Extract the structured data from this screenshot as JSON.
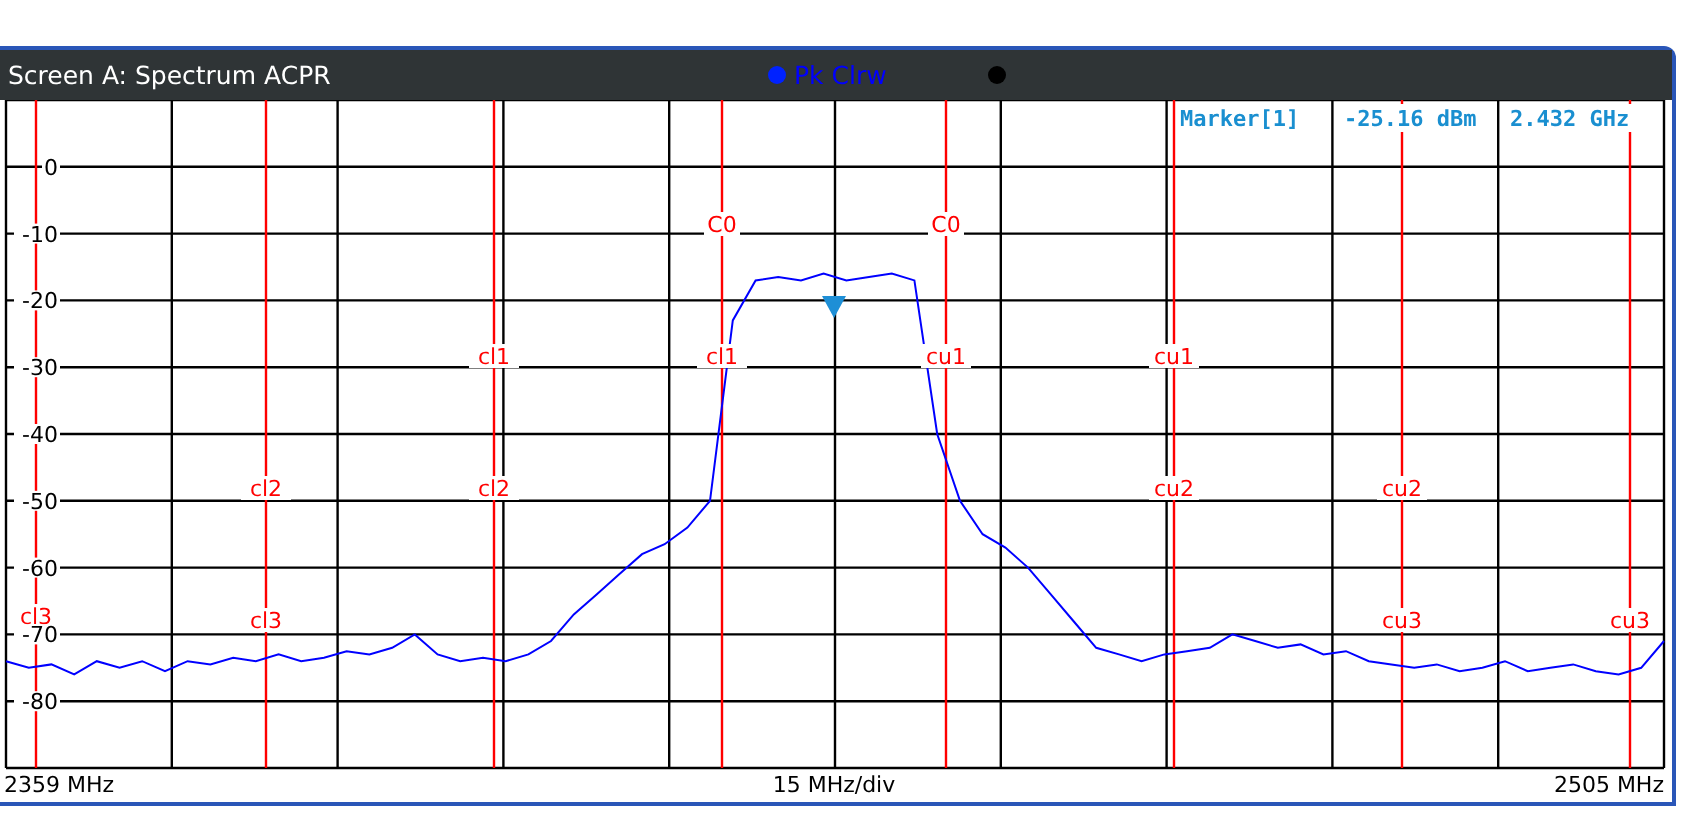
{
  "window": {
    "title": "Screen A: Spectrum ACPR"
  },
  "marker": {
    "name": "Marker[1]",
    "level_reading": "-25.16 dBm",
    "frequency": "2.432 GHz"
  },
  "channel_labels": [
    {
      "text": "C0"
    },
    {
      "text": "C0"
    },
    {
      "text": "cl1"
    },
    {
      "text": "cl1"
    },
    {
      "text": "cu1"
    },
    {
      "text": "cu1"
    },
    {
      "text": "cl2"
    },
    {
      "text": "cl2"
    },
    {
      "text": "cu2"
    },
    {
      "text": "cu2"
    },
    {
      "text": "cl3"
    },
    {
      "text": "cl3"
    },
    {
      "text": "cu3"
    },
    {
      "text": "cu3"
    }
  ],
  "chart_data": {
    "type": "line",
    "grid": true,
    "ylim": [
      -90,
      10
    ],
    "yticks": [
      0,
      -10,
      -20,
      -30,
      -40,
      -50,
      -60,
      -70,
      -80
    ],
    "categories": [
      null,
      null,
      null,
      null,
      null,
      null,
      null,
      null,
      null,
      null,
      null,
      null,
      null,
      null,
      null,
      null,
      null,
      null,
      null,
      null,
      null,
      null,
      null,
      null,
      null,
      null,
      null,
      null,
      null,
      null,
      null,
      null,
      null,
      null,
      null,
      null,
      null,
      null,
      null,
      null,
      null,
      null,
      null,
      null,
      null,
      null,
      null,
      null,
      null,
      null,
      null,
      null,
      null,
      null,
      null,
      null,
      null,
      null,
      null,
      null,
      null,
      null,
      null,
      null,
      null,
      null,
      null,
      null,
      null,
      null,
      null,
      null,
      null,
      null
    ],
    "series": [
      {
        "name": "Pk Clrw",
        "color": "#0000ff",
        "values": [
          -74,
          -75,
          -74.5,
          -76,
          -74,
          -75,
          -74,
          -75.5,
          -74,
          -74.5,
          -73.5,
          -74,
          -73,
          -74,
          -73.5,
          -72.5,
          -73,
          -72,
          -70,
          -73,
          -74,
          -73.5,
          -74,
          -73,
          -71,
          -67,
          -64,
          -61,
          -58,
          -56.5,
          -54,
          -50,
          -23,
          -17,
          -16.5,
          -17,
          -16,
          -17,
          -16.5,
          -16,
          -17,
          -40,
          -50,
          -55,
          -57,
          -60,
          -64,
          -68,
          -72,
          -73,
          -74,
          -73,
          -72.5,
          -72,
          -70,
          -71,
          -72,
          -71.5,
          -73,
          -72.5,
          -74,
          -74.5,
          -75,
          -74.5,
          -75.5,
          -75,
          -74,
          -75.5,
          -75,
          -74.5,
          -75.5,
          -76,
          -75,
          -71
        ]
      }
    ]
  },
  "footer": {
    "start": "2359 MHz",
    "scale": "15 MHz/div",
    "stop": "2505 MHz"
  }
}
